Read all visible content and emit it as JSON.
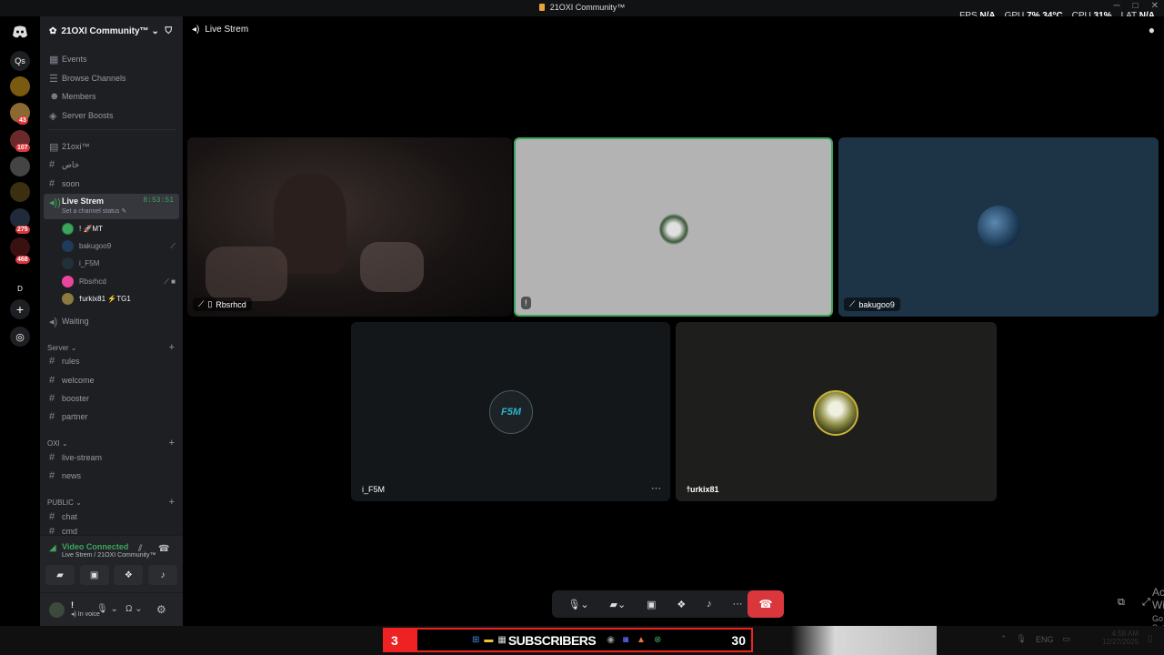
{
  "window": {
    "title": "21OXI Community™"
  },
  "hud": {
    "fps_label": "FPS",
    "fps_value": "N/A",
    "gpu_label": "GPU",
    "gpu_value": "7%",
    "gpu_temp": "34°C",
    "cpu_label": "CPU",
    "cpu_value": "31%",
    "lat_label": "LAT",
    "lat_value": "N/A"
  },
  "rail": {
    "badges": [
      "43",
      "107",
      "275",
      "468"
    ],
    "letter_labels": [
      "Qs",
      "D"
    ]
  },
  "sidebar": {
    "server_name": "21OXI Community™",
    "top_items": [
      {
        "label": "Events",
        "icon": "calendar-icon"
      },
      {
        "label": "Browse Channels",
        "icon": "list-icon"
      },
      {
        "label": "Members",
        "icon": "members-icon"
      },
      {
        "label": "Server Boosts",
        "icon": "boost-icon"
      }
    ],
    "channels_a": [
      {
        "label": "21oxi™",
        "icon": "announce-icon"
      },
      {
        "label": "خاص",
        "icon": "hash-icon"
      },
      {
        "label": "soon",
        "icon": "hash-icon"
      }
    ],
    "live_channel": {
      "label": "Live Strem",
      "timer": "8:53:51",
      "status": "Set a channel status"
    },
    "voice_users": [
      {
        "name": "! 🚀MT",
        "color": "#3ba55d"
      },
      {
        "name": "bakugoo9",
        "color": "#1f3a5a"
      },
      {
        "name": "i_F5M",
        "color": "#22303a"
      },
      {
        "name": "Rbsrhcd",
        "color": "#eb459e"
      },
      {
        "name": "ϯurkix81 ⚡TG1",
        "color": "#8a7a40"
      }
    ],
    "waiting": "Waiting",
    "cat_server": "Server",
    "server_channels": [
      "rules",
      "welcome",
      "booster",
      "partner"
    ],
    "cat_oxi": "OXI",
    "oxi_channels": [
      "live-stream",
      "news"
    ],
    "cat_public": "PUBLIC",
    "public_channels": [
      "chat",
      "cmd"
    ]
  },
  "voice": {
    "status": "Video Connected",
    "location": "Live Strem / 21OXI Community™"
  },
  "user": {
    "name": "!",
    "status": "In voice"
  },
  "main": {
    "channel_title": "Live Strem"
  },
  "tiles": [
    {
      "name": "Rbsrhcd"
    },
    {
      "name": "!"
    },
    {
      "name": "bakugoo9"
    },
    {
      "name": "i_F5M",
      "avatar_text": "F5M"
    },
    {
      "name": "ϯurkix81"
    }
  ],
  "activate": {
    "title": "Activate Windows",
    "subtitle": "Go to Settings to activate Windows."
  },
  "subscribers": {
    "left": "3",
    "label": "SUBSCRIBERS",
    "right": "30"
  },
  "tray": {
    "lang": "ENG",
    "time": "4:58 AM",
    "date": "12/27/2025"
  },
  "colors": {
    "accent": "#3ba55d",
    "danger": "#da373c",
    "tile_gray": "#b3b3b3",
    "tile_blue": "#1d3346"
  }
}
